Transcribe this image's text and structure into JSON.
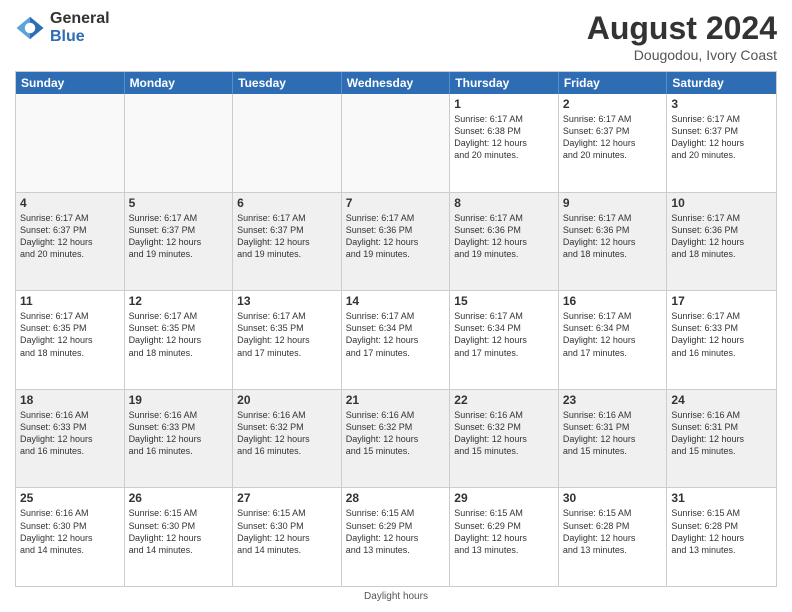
{
  "logo": {
    "general": "General",
    "blue": "Blue"
  },
  "title": "August 2024",
  "location": "Dougodou, Ivory Coast",
  "days_header": [
    "Sunday",
    "Monday",
    "Tuesday",
    "Wednesday",
    "Thursday",
    "Friday",
    "Saturday"
  ],
  "footer": "Daylight hours",
  "weeks": [
    [
      {
        "day": "",
        "info": "",
        "empty": true
      },
      {
        "day": "",
        "info": "",
        "empty": true
      },
      {
        "day": "",
        "info": "",
        "empty": true
      },
      {
        "day": "",
        "info": "",
        "empty": true
      },
      {
        "day": "1",
        "info": "Sunrise: 6:17 AM\nSunset: 6:38 PM\nDaylight: 12 hours\nand 20 minutes.",
        "empty": false
      },
      {
        "day": "2",
        "info": "Sunrise: 6:17 AM\nSunset: 6:37 PM\nDaylight: 12 hours\nand 20 minutes.",
        "empty": false
      },
      {
        "day": "3",
        "info": "Sunrise: 6:17 AM\nSunset: 6:37 PM\nDaylight: 12 hours\nand 20 minutes.",
        "empty": false
      }
    ],
    [
      {
        "day": "4",
        "info": "Sunrise: 6:17 AM\nSunset: 6:37 PM\nDaylight: 12 hours\nand 20 minutes.",
        "empty": false
      },
      {
        "day": "5",
        "info": "Sunrise: 6:17 AM\nSunset: 6:37 PM\nDaylight: 12 hours\nand 19 minutes.",
        "empty": false
      },
      {
        "day": "6",
        "info": "Sunrise: 6:17 AM\nSunset: 6:37 PM\nDaylight: 12 hours\nand 19 minutes.",
        "empty": false
      },
      {
        "day": "7",
        "info": "Sunrise: 6:17 AM\nSunset: 6:36 PM\nDaylight: 12 hours\nand 19 minutes.",
        "empty": false
      },
      {
        "day": "8",
        "info": "Sunrise: 6:17 AM\nSunset: 6:36 PM\nDaylight: 12 hours\nand 19 minutes.",
        "empty": false
      },
      {
        "day": "9",
        "info": "Sunrise: 6:17 AM\nSunset: 6:36 PM\nDaylight: 12 hours\nand 18 minutes.",
        "empty": false
      },
      {
        "day": "10",
        "info": "Sunrise: 6:17 AM\nSunset: 6:36 PM\nDaylight: 12 hours\nand 18 minutes.",
        "empty": false
      }
    ],
    [
      {
        "day": "11",
        "info": "Sunrise: 6:17 AM\nSunset: 6:35 PM\nDaylight: 12 hours\nand 18 minutes.",
        "empty": false
      },
      {
        "day": "12",
        "info": "Sunrise: 6:17 AM\nSunset: 6:35 PM\nDaylight: 12 hours\nand 18 minutes.",
        "empty": false
      },
      {
        "day": "13",
        "info": "Sunrise: 6:17 AM\nSunset: 6:35 PM\nDaylight: 12 hours\nand 17 minutes.",
        "empty": false
      },
      {
        "day": "14",
        "info": "Sunrise: 6:17 AM\nSunset: 6:34 PM\nDaylight: 12 hours\nand 17 minutes.",
        "empty": false
      },
      {
        "day": "15",
        "info": "Sunrise: 6:17 AM\nSunset: 6:34 PM\nDaylight: 12 hours\nand 17 minutes.",
        "empty": false
      },
      {
        "day": "16",
        "info": "Sunrise: 6:17 AM\nSunset: 6:34 PM\nDaylight: 12 hours\nand 17 minutes.",
        "empty": false
      },
      {
        "day": "17",
        "info": "Sunrise: 6:17 AM\nSunset: 6:33 PM\nDaylight: 12 hours\nand 16 minutes.",
        "empty": false
      }
    ],
    [
      {
        "day": "18",
        "info": "Sunrise: 6:16 AM\nSunset: 6:33 PM\nDaylight: 12 hours\nand 16 minutes.",
        "empty": false
      },
      {
        "day": "19",
        "info": "Sunrise: 6:16 AM\nSunset: 6:33 PM\nDaylight: 12 hours\nand 16 minutes.",
        "empty": false
      },
      {
        "day": "20",
        "info": "Sunrise: 6:16 AM\nSunset: 6:32 PM\nDaylight: 12 hours\nand 16 minutes.",
        "empty": false
      },
      {
        "day": "21",
        "info": "Sunrise: 6:16 AM\nSunset: 6:32 PM\nDaylight: 12 hours\nand 15 minutes.",
        "empty": false
      },
      {
        "day": "22",
        "info": "Sunrise: 6:16 AM\nSunset: 6:32 PM\nDaylight: 12 hours\nand 15 minutes.",
        "empty": false
      },
      {
        "day": "23",
        "info": "Sunrise: 6:16 AM\nSunset: 6:31 PM\nDaylight: 12 hours\nand 15 minutes.",
        "empty": false
      },
      {
        "day": "24",
        "info": "Sunrise: 6:16 AM\nSunset: 6:31 PM\nDaylight: 12 hours\nand 15 minutes.",
        "empty": false
      }
    ],
    [
      {
        "day": "25",
        "info": "Sunrise: 6:16 AM\nSunset: 6:30 PM\nDaylight: 12 hours\nand 14 minutes.",
        "empty": false
      },
      {
        "day": "26",
        "info": "Sunrise: 6:15 AM\nSunset: 6:30 PM\nDaylight: 12 hours\nand 14 minutes.",
        "empty": false
      },
      {
        "day": "27",
        "info": "Sunrise: 6:15 AM\nSunset: 6:30 PM\nDaylight: 12 hours\nand 14 minutes.",
        "empty": false
      },
      {
        "day": "28",
        "info": "Sunrise: 6:15 AM\nSunset: 6:29 PM\nDaylight: 12 hours\nand 13 minutes.",
        "empty": false
      },
      {
        "day": "29",
        "info": "Sunrise: 6:15 AM\nSunset: 6:29 PM\nDaylight: 12 hours\nand 13 minutes.",
        "empty": false
      },
      {
        "day": "30",
        "info": "Sunrise: 6:15 AM\nSunset: 6:28 PM\nDaylight: 12 hours\nand 13 minutes.",
        "empty": false
      },
      {
        "day": "31",
        "info": "Sunrise: 6:15 AM\nSunset: 6:28 PM\nDaylight: 12 hours\nand 13 minutes.",
        "empty": false
      }
    ]
  ]
}
